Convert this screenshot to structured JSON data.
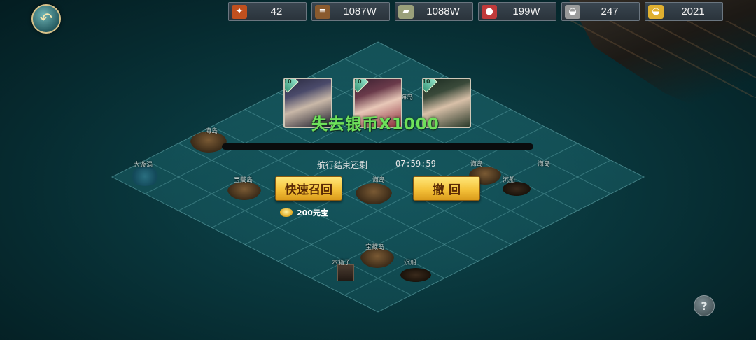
{
  "resources": [
    {
      "icon": "token-icon",
      "value": "42",
      "color": "#c0501e"
    },
    {
      "icon": "wood-icon",
      "value": "1087W",
      "color": "#8a5a2e"
    },
    {
      "icon": "stone-icon",
      "value": "1088W",
      "color": "#9aa07a"
    },
    {
      "icon": "meat-icon",
      "value": "199W",
      "color": "#c03a3a"
    },
    {
      "icon": "silver-icon",
      "value": "247",
      "color": "#c8c8c8"
    },
    {
      "icon": "gold-ingot-icon",
      "value": "2021",
      "color": "#e0b030"
    }
  ],
  "heroes": [
    {
      "level": "10",
      "name": "hero-1"
    },
    {
      "level": "10",
      "name": "hero-2"
    },
    {
      "level": "10",
      "name": "hero-3"
    }
  ],
  "voyage": {
    "lose_message": "失去银币X1000",
    "timer_label": "航行结束还剩",
    "timer_value": "07:59:59"
  },
  "buttons": {
    "quick_recall": "快速召回",
    "retreat": "撤 回"
  },
  "cost": {
    "text": "200元宝"
  },
  "map_labels": [
    "海岛",
    "大漩涡",
    "宝藏岛",
    "海岛",
    "海岛",
    "海岛",
    "沉船",
    "海岛",
    "宝藏岛",
    "木箱子",
    "沉船"
  ],
  "help": "?"
}
